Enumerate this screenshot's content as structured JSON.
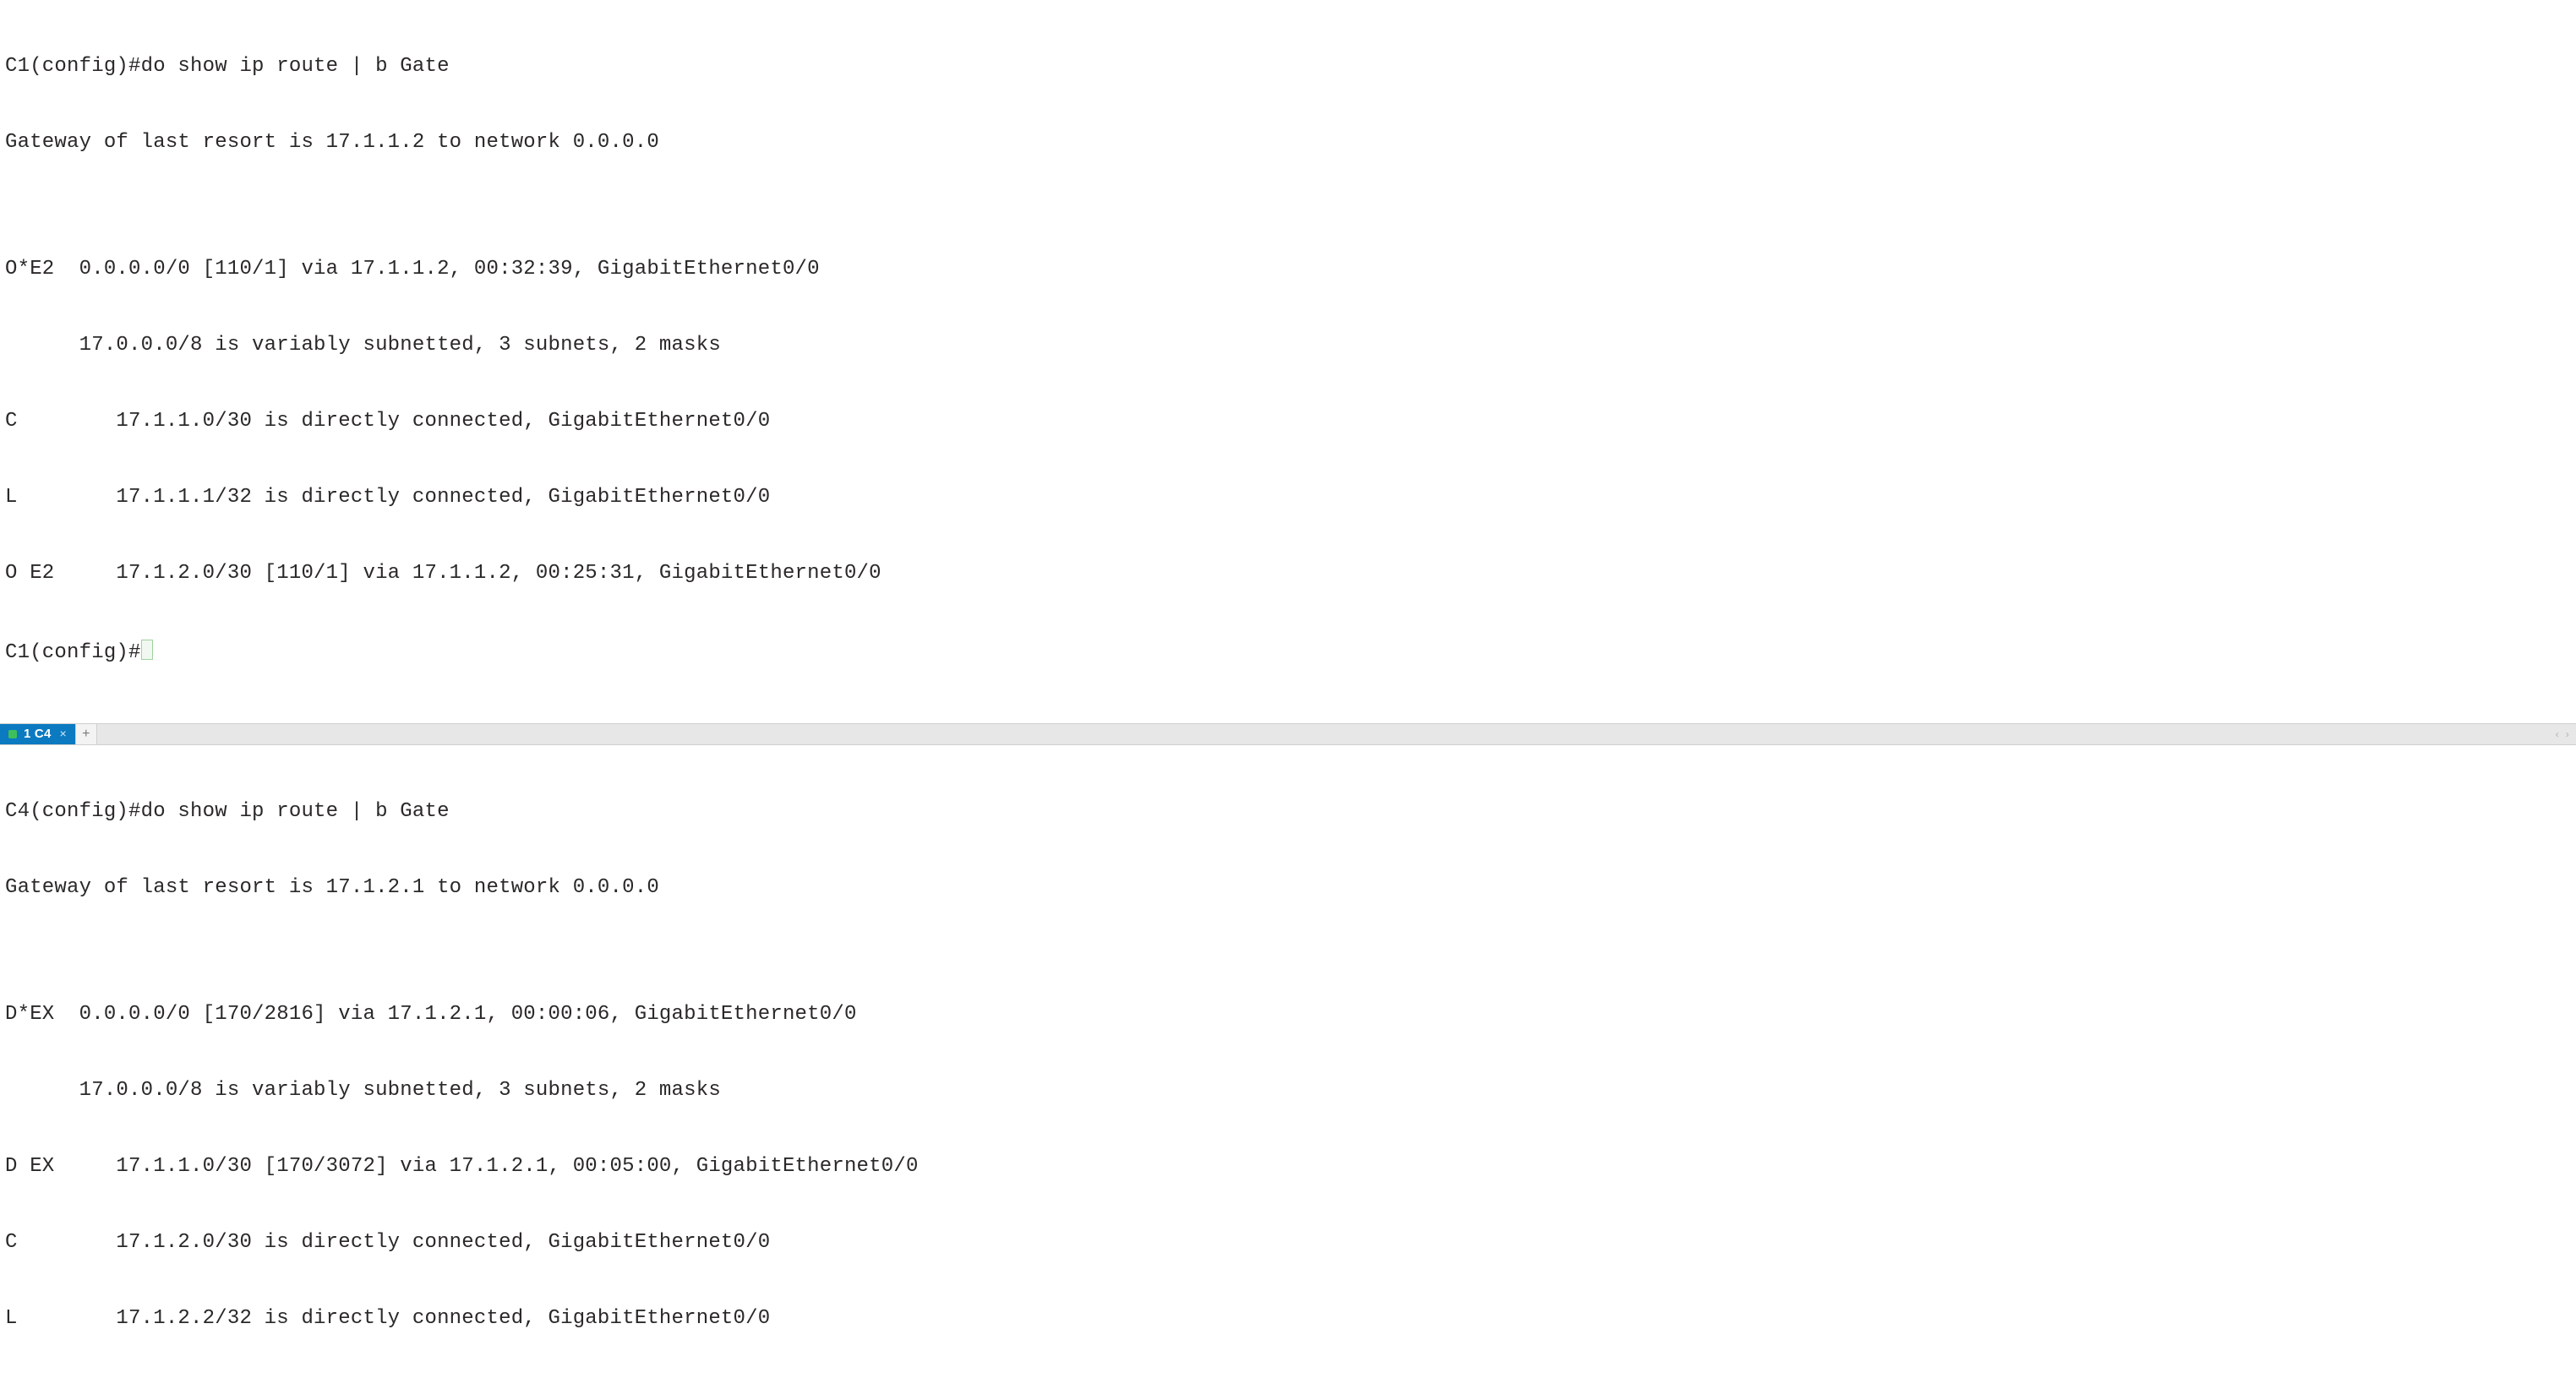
{
  "tabbar": {
    "active_tab": {
      "label": "1 C4"
    },
    "add_label": "+",
    "right_arrows": {
      "left": "‹",
      "right": "›"
    }
  },
  "pane_top": {
    "lines": [
      "C1(config)#do show ip route | b Gate",
      "Gateway of last resort is 17.1.1.2 to network 0.0.0.0",
      "",
      "O*E2  0.0.0.0/0 [110/1] via 17.1.1.2, 00:32:39, GigabitEthernet0/0",
      "      17.0.0.0/8 is variably subnetted, 3 subnets, 2 masks",
      "C        17.1.1.0/30 is directly connected, GigabitEthernet0/0",
      "L        17.1.1.1/32 is directly connected, GigabitEthernet0/0",
      "O E2     17.1.2.0/30 [110/1] via 17.1.1.2, 00:25:31, GigabitEthernet0/0"
    ],
    "prompt": "C1(config)#"
  },
  "pane_bottom": {
    "lines": [
      "C4(config)#do show ip route | b Gate",
      "Gateway of last resort is 17.1.2.1 to network 0.0.0.0",
      "",
      "D*EX  0.0.0.0/0 [170/2816] via 17.1.2.1, 00:00:06, GigabitEthernet0/0",
      "      17.0.0.0/8 is variably subnetted, 3 subnets, 2 masks",
      "D EX     17.1.1.0/30 [170/3072] via 17.1.2.1, 00:05:00, GigabitEthernet0/0",
      "C        17.1.2.0/30 is directly connected, GigabitEthernet0/0",
      "L        17.1.2.2/32 is directly connected, GigabitEthernet0/0"
    ]
  }
}
